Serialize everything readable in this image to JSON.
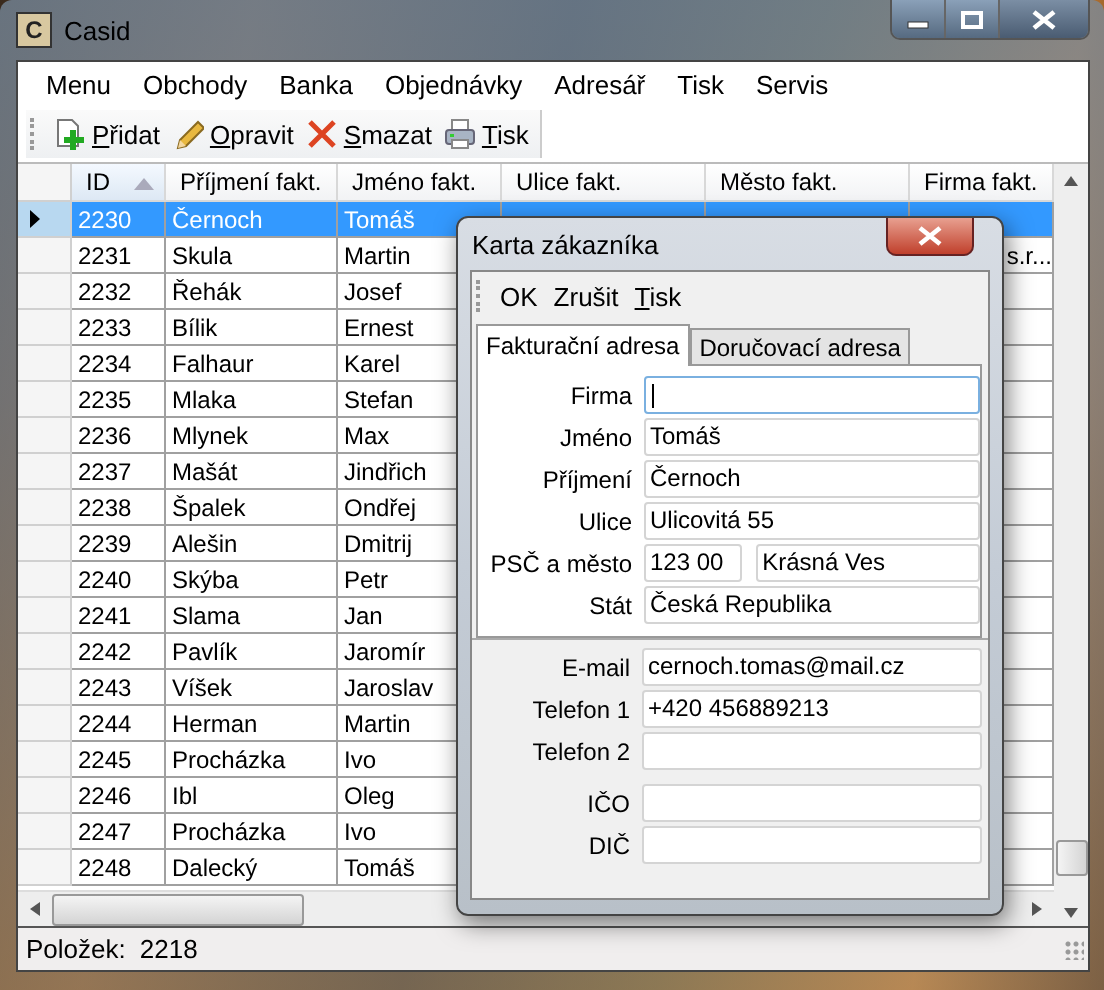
{
  "window": {
    "title": "Casid",
    "icon_letter": "C"
  },
  "menu": [
    "Menu",
    "Obchody",
    "Banka",
    "Objednávky",
    "Adresář",
    "Tisk",
    "Servis"
  ],
  "toolbar": [
    {
      "label": "Přidat",
      "mnemonic": true
    },
    {
      "label": "Opravit",
      "mnemonic": true
    },
    {
      "label": "Smazat",
      "mnemonic": true
    },
    {
      "label": "Tisk",
      "mnemonic": true
    }
  ],
  "table": {
    "columns": [
      {
        "label": "ID",
        "sorted": true
      },
      {
        "label": "Příjmení fakt.",
        "sorted": false
      },
      {
        "label": "Jméno fakt.",
        "sorted": false
      },
      {
        "label": "Ulice fakt.",
        "sorted": false
      },
      {
        "label": "Město fakt.",
        "sorted": false
      },
      {
        "label": "Firma fakt.",
        "sorted": false
      }
    ],
    "rows": [
      {
        "selected": true,
        "cells": [
          "2230",
          "Černoch",
          "Tomáš"
        ]
      },
      {
        "selected": false,
        "cells": [
          "2231",
          "Skula",
          "Martin"
        ],
        "firma": "s.r..."
      },
      {
        "selected": false,
        "cells": [
          "2232",
          "Řehák",
          "Josef"
        ]
      },
      {
        "selected": false,
        "cells": [
          "2233",
          "Bílik",
          "Ernest"
        ]
      },
      {
        "selected": false,
        "cells": [
          "2234",
          "Falhaur",
          "Karel"
        ]
      },
      {
        "selected": false,
        "cells": [
          "2235",
          "Mlaka",
          "Stefan"
        ]
      },
      {
        "selected": false,
        "cells": [
          "2236",
          "Mlynek",
          "Max"
        ]
      },
      {
        "selected": false,
        "cells": [
          "2237",
          "Mašát",
          "Jindřich"
        ]
      },
      {
        "selected": false,
        "cells": [
          "2238",
          "Špalek",
          "Ondřej"
        ]
      },
      {
        "selected": false,
        "cells": [
          "2239",
          "Alešin",
          "Dmitrij"
        ]
      },
      {
        "selected": false,
        "cells": [
          "2240",
          "Skýba",
          "Petr"
        ]
      },
      {
        "selected": false,
        "cells": [
          "2241",
          "Slama",
          "Jan"
        ]
      },
      {
        "selected": false,
        "cells": [
          "2242",
          "Pavlík",
          "Jaromír"
        ]
      },
      {
        "selected": false,
        "cells": [
          "2243",
          "Víšek",
          "Jaroslav"
        ]
      },
      {
        "selected": false,
        "cells": [
          "2244",
          "Herman",
          "Martin"
        ]
      },
      {
        "selected": false,
        "cells": [
          "2245",
          "Procházka",
          "Ivo"
        ]
      },
      {
        "selected": false,
        "cells": [
          "2246",
          "Ibl",
          "Oleg"
        ]
      },
      {
        "selected": false,
        "cells": [
          "2247",
          "Procházka",
          "Ivo"
        ]
      },
      {
        "selected": false,
        "cells": [
          "2248",
          "Dalecký",
          "Tomáš"
        ]
      }
    ]
  },
  "status_bar": {
    "label": "Položek:",
    "value": "2218"
  },
  "dialog": {
    "title": "Karta zákazníka",
    "toolbar": [
      {
        "label": "OK",
        "mnemonic": false
      },
      {
        "label": "Zrušit",
        "mnemonic": false
      },
      {
        "label": "Tisk",
        "mnemonic": true
      }
    ],
    "tabs": [
      {
        "label": "Fakturační adresa",
        "selected": true
      },
      {
        "label": "Doručovací adresa",
        "selected": false
      }
    ],
    "address_fields": [
      {
        "kind": "single",
        "label": "Firma",
        "focused": true
      },
      {
        "kind": "single",
        "label": "Jméno",
        "value": "Tomáš",
        "focused": false
      },
      {
        "kind": "single",
        "label": "Příjmení",
        "value": "Černoch",
        "focused": false
      },
      {
        "kind": "single",
        "label": "Ulice",
        "value": "Ulicovitá 55",
        "focused": false
      },
      {
        "kind": "pair",
        "label": "PSČ a město",
        "value": "123 00",
        "value_2": "Krásná Ves",
        "focused": false
      },
      {
        "kind": "single",
        "label": "Stát",
        "value": "Česká Republika",
        "focused": false
      }
    ],
    "contact_fields": [
      {
        "kind": "single",
        "label": "E-mail",
        "value": "cernoch.tomas@mail.cz",
        "focused": false
      },
      {
        "kind": "single",
        "label": "Telefon 1",
        "value": "+420 456889213",
        "focused": false
      },
      {
        "kind": "single",
        "label": "Telefon 2",
        "focused": false
      }
    ],
    "id_fields": [
      {
        "kind": "single",
        "label": "IČO",
        "focused": false
      },
      {
        "kind": "single",
        "label": "DIČ",
        "focused": false
      }
    ]
  }
}
